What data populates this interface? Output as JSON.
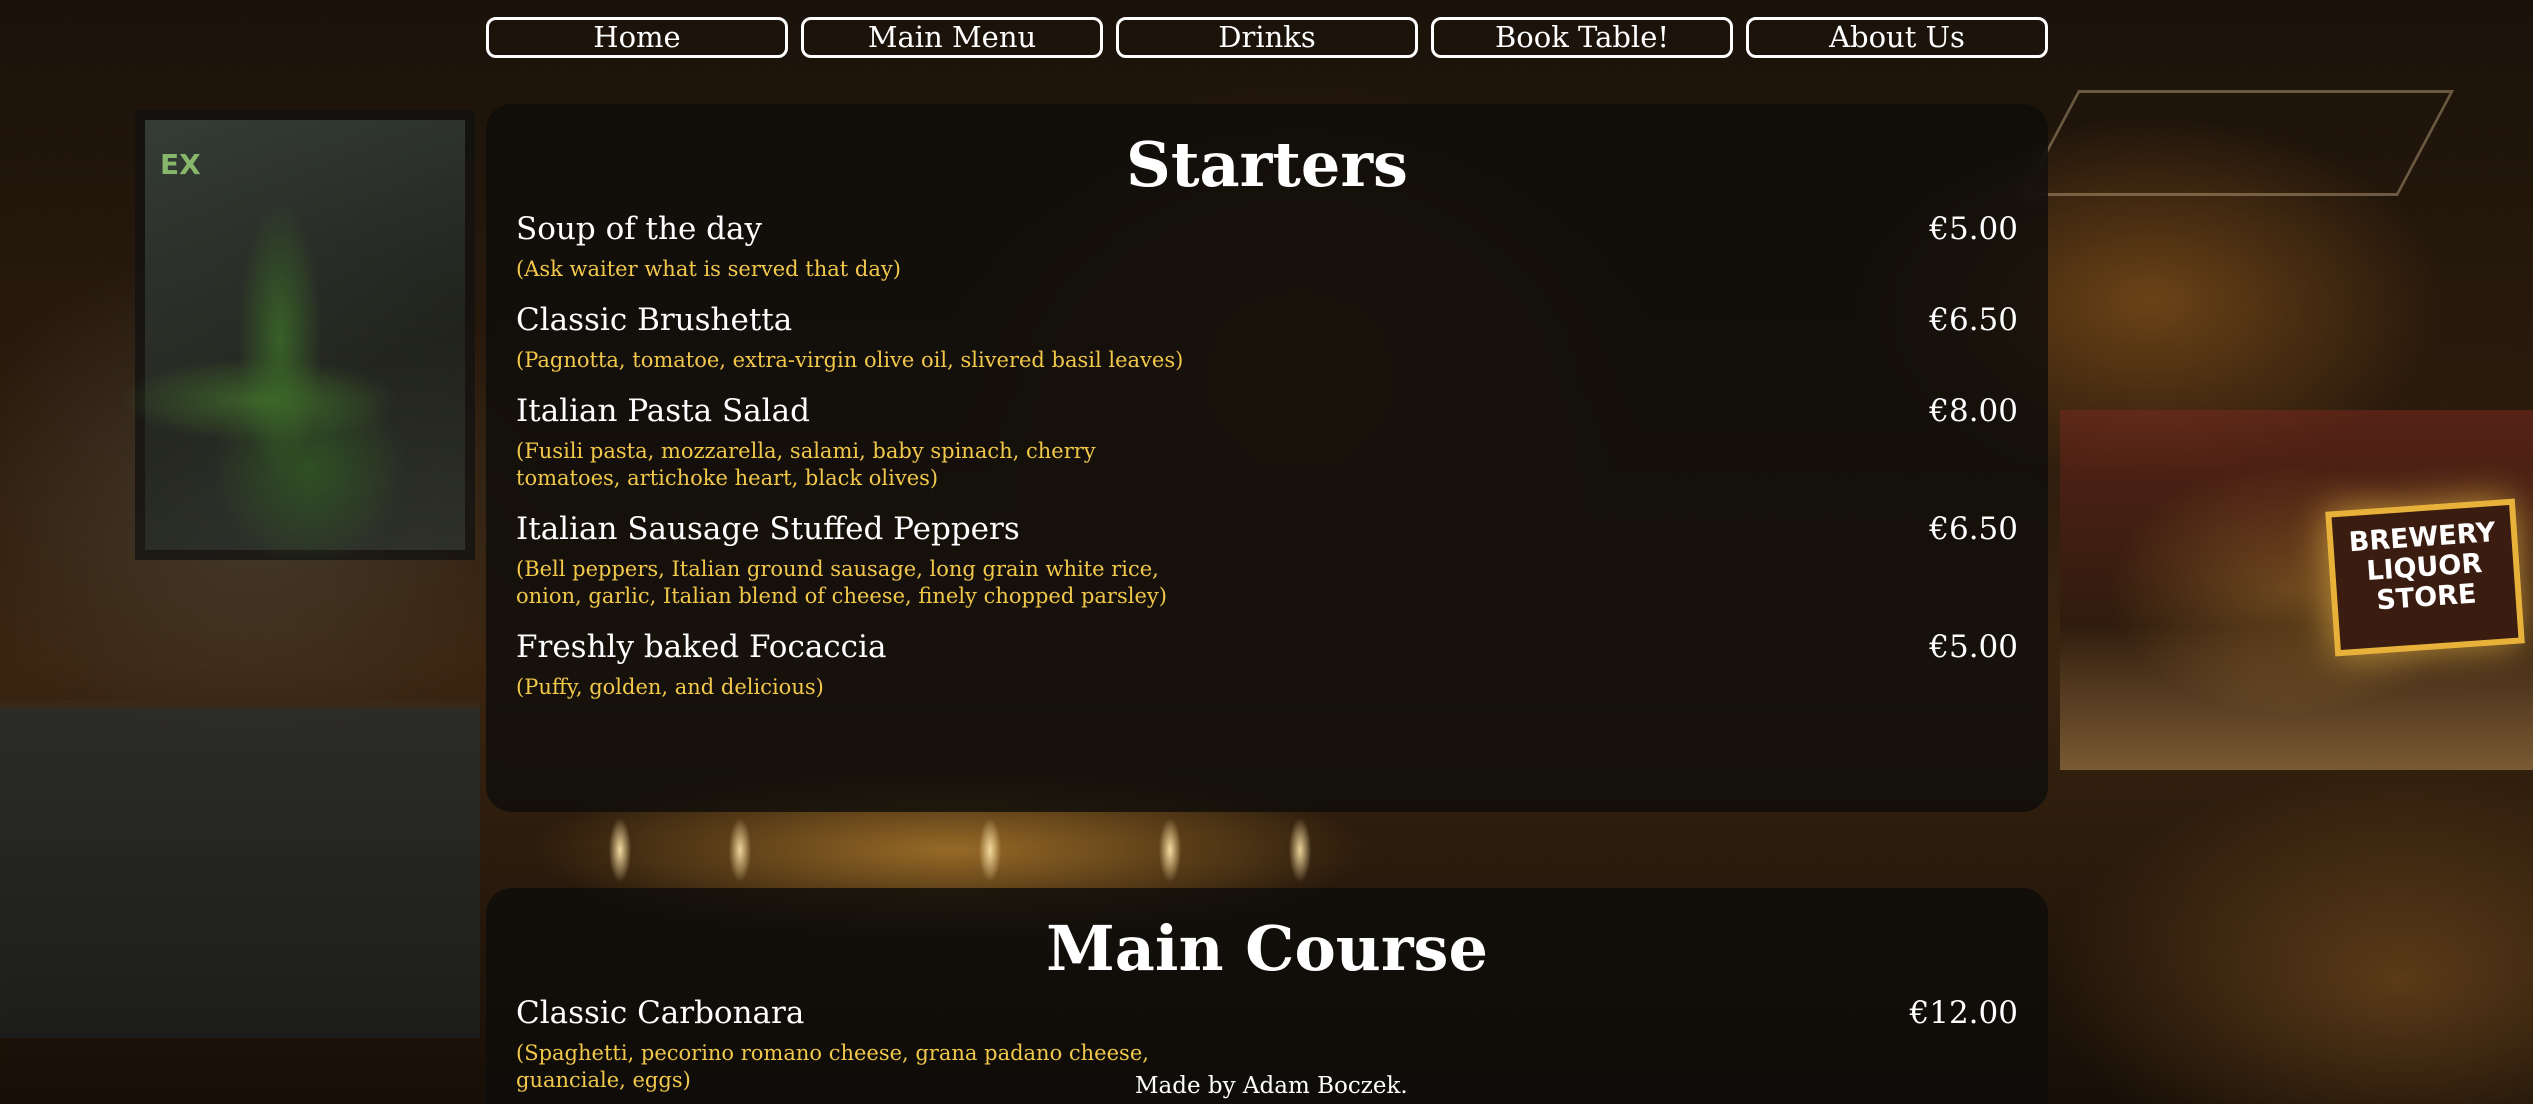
{
  "nav": {
    "items": [
      {
        "label": "Home"
      },
      {
        "label": "Main Menu"
      },
      {
        "label": "Drinks"
      },
      {
        "label": "Book Table!"
      },
      {
        "label": "About Us"
      }
    ]
  },
  "background": {
    "sign_text": "BREWERY LIQUOR STORE",
    "exit_text": "EX"
  },
  "starters": {
    "title": "Starters",
    "items": [
      {
        "name": "Soup of the day",
        "price": "€5.00",
        "description": "(Ask waiter what is served that day)"
      },
      {
        "name": "Classic Brushetta",
        "price": "€6.50",
        "description": "(Pagnotta, tomatoe, extra-virgin olive oil, slivered basil leaves)"
      },
      {
        "name": "Italian Pasta Salad",
        "price": "€8.00",
        "description": "(Fusili pasta, mozzarella, salami, baby spinach, cherry tomatoes, artichoke heart, black olives)"
      },
      {
        "name": "Italian Sausage Stuffed Peppers",
        "price": "€6.50",
        "description": "(Bell peppers, Italian ground sausage, long grain white rice, onion, garlic, Italian blend of cheese, finely chopped parsley)"
      },
      {
        "name": "Freshly baked Focaccia",
        "price": "€5.00",
        "description": "(Puffy, golden, and delicious)"
      }
    ]
  },
  "main_course": {
    "title": "Main Course",
    "items": [
      {
        "name": "Classic Carbonara",
        "price": "€12.00",
        "description": "(Spaghetti, pecorino romano cheese, grana padano cheese, guanciale, eggs)"
      }
    ]
  },
  "footer": {
    "credit": "Made by Adam Boczek."
  },
  "colors": {
    "accent": "#f2c84a",
    "text": "#ffffff",
    "panel": "#0e0c0a"
  }
}
